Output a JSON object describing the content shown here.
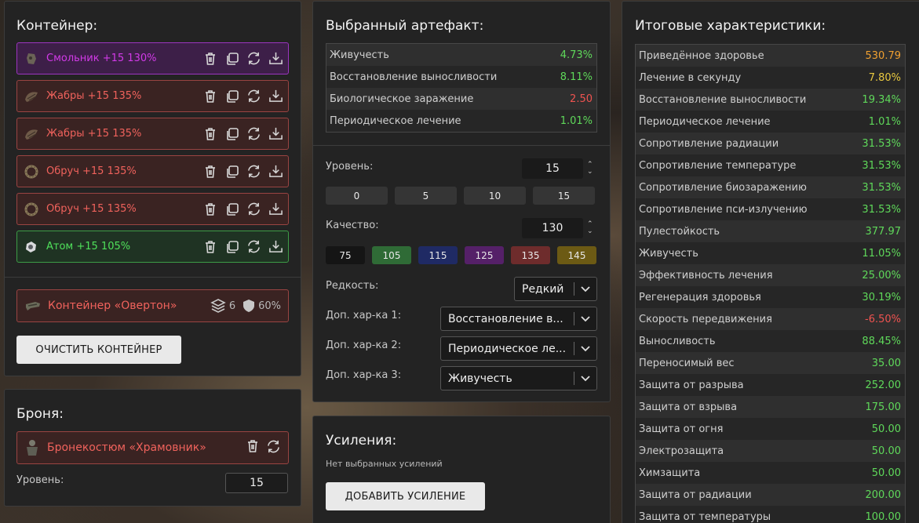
{
  "container": {
    "title": "Контейнер:",
    "items": [
      {
        "label": "Смольник +15 130%",
        "color": "purple"
      },
      {
        "label": "Жабры +15 135%",
        "color": "red"
      },
      {
        "label": "Жабры +15 135%",
        "color": "red"
      },
      {
        "label": "Обруч +15 135%",
        "color": "red"
      },
      {
        "label": "Обруч +15 135%",
        "color": "red"
      },
      {
        "label": "Атом +15 105%",
        "color": "green"
      }
    ],
    "card": {
      "label": "Контейнер «Овертон»",
      "slots": "6",
      "protection": "60%"
    },
    "clear_button": "ОЧИСТИТЬ КОНТЕЙНЕР"
  },
  "armor": {
    "title": "Броня:",
    "card_label": "Бронекостюм «Храмовник»",
    "level_label": "Уровень:",
    "level_value": "15"
  },
  "artifact": {
    "title": "Выбранный артефакт:",
    "stats": [
      {
        "name": "Живучесть",
        "value": "4.73%",
        "tone": "green"
      },
      {
        "name": "Восстановление выносливости",
        "value": "8.11%",
        "tone": "green"
      },
      {
        "name": "Биологическое заражение",
        "value": "2.50",
        "tone": "red"
      },
      {
        "name": "Периодическое лечение",
        "value": "1.01%",
        "tone": "green"
      }
    ],
    "level_label": "Уровень:",
    "level_value": "15",
    "level_presets": [
      "0",
      "5",
      "10",
      "15"
    ],
    "quality_label": "Качество:",
    "quality_value": "130",
    "quality_presets": [
      "75",
      "105",
      "115",
      "125",
      "135",
      "145"
    ],
    "rarity_label": "Редкость:",
    "rarity_value": "Редкий",
    "extra1_label": "Доп. хар-ка 1:",
    "extra1_value": "Восстановление в...",
    "extra2_label": "Доп. хар-ка 2:",
    "extra2_value": "Периодическое ле...",
    "extra3_label": "Доп. хар-ка 3:",
    "extra3_value": "Живучесть"
  },
  "boosts": {
    "title": "Усиления:",
    "empty_text": "Нет выбранных усилений",
    "add_button": "ДОБАВИТЬ УСИЛЕНИЕ"
  },
  "totals": {
    "title": "Итоговые характеристики:",
    "rows": [
      {
        "name": "Приведённое здоровье",
        "value": "530.79",
        "tone": "orange"
      },
      {
        "name": "Лечение в секунду",
        "value": "7.80%",
        "tone": "yellow"
      },
      {
        "name": "Восстановление выносливости",
        "value": "19.34%",
        "tone": "green"
      },
      {
        "name": "Периодическое лечение",
        "value": "1.01%",
        "tone": "green"
      },
      {
        "name": "Сопротивление радиации",
        "value": "31.53%",
        "tone": "green"
      },
      {
        "name": "Сопротивление температуре",
        "value": "31.53%",
        "tone": "green"
      },
      {
        "name": "Сопротивление биозаражению",
        "value": "31.53%",
        "tone": "green"
      },
      {
        "name": "Сопротивление пси-излучению",
        "value": "31.53%",
        "tone": "green"
      },
      {
        "name": "Пулестойкость",
        "value": "377.97",
        "tone": "green"
      },
      {
        "name": "Живучесть",
        "value": "11.05%",
        "tone": "green"
      },
      {
        "name": "Эффективность лечения",
        "value": "25.00%",
        "tone": "green"
      },
      {
        "name": "Регенерация здоровья",
        "value": "30.19%",
        "tone": "green"
      },
      {
        "name": "Скорость передвижения",
        "value": "-6.50%",
        "tone": "red"
      },
      {
        "name": "Выносливость",
        "value": "88.45%",
        "tone": "green"
      },
      {
        "name": "Переносимый вес",
        "value": "35.00",
        "tone": "green"
      },
      {
        "name": "Защита от разрыва",
        "value": "252.00",
        "tone": "green"
      },
      {
        "name": "Защита от взрыва",
        "value": "175.00",
        "tone": "green"
      },
      {
        "name": "Защита от огня",
        "value": "50.00",
        "tone": "green"
      },
      {
        "name": "Электрозащита",
        "value": "50.00",
        "tone": "green"
      },
      {
        "name": "Химзащита",
        "value": "50.00",
        "tone": "green"
      },
      {
        "name": "Защита от радиации",
        "value": "200.00",
        "tone": "green"
      },
      {
        "name": "Защита от температуры",
        "value": "100.00",
        "tone": "green"
      }
    ]
  },
  "colors": {
    "green": "#5fd95a",
    "red": "#ef5350",
    "orange": "#f0a030",
    "yellow": "#e8c840",
    "purple": "#d23ae8"
  },
  "icons": [
    "trash-icon",
    "copy-icon",
    "refresh-icon",
    "download-icon",
    "layers-icon",
    "shield-icon",
    "chevron-down-icon"
  ]
}
